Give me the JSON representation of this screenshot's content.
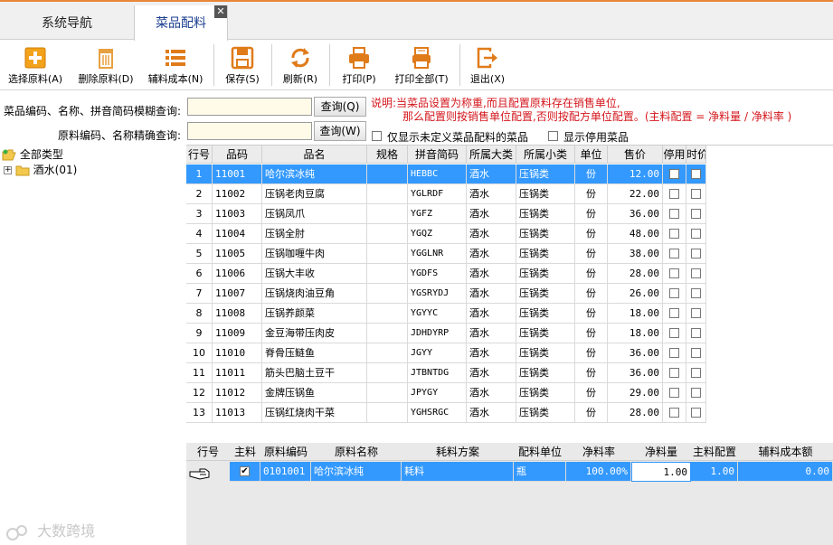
{
  "tabs": [
    {
      "label": "系统导航"
    },
    {
      "label": "菜品配料"
    }
  ],
  "tab_close": "✕",
  "toolbar": [
    {
      "label": "选择原料(A)",
      "icon": "plus-icon"
    },
    {
      "label": "删除原料(D)",
      "icon": "trash-icon"
    },
    {
      "label": "辅料成本(N)",
      "icon": "list-icon"
    },
    {
      "label": "保存(S)",
      "icon": "save-icon"
    },
    {
      "label": "刷新(R)",
      "icon": "refresh-icon"
    },
    {
      "label": "打印(P)",
      "icon": "printer-icon"
    },
    {
      "label": "打印全部(T)",
      "icon": "print-all-icon"
    },
    {
      "label": "退出(X)",
      "icon": "exit-icon"
    }
  ],
  "search": {
    "fuzzy_label": "菜品编码、名称、拼音简码模糊查询:",
    "fuzzy_value": "",
    "query1_label": "查询(Q)",
    "exact_label": "原料编码、名称精确查询:",
    "exact_value": "",
    "query2_label": "查询(W)"
  },
  "note": {
    "line1": "说明:当菜品设置为称重,而且配置原料存在销售单位,",
    "line2": "那么配置则按销售单位配置,否则按配方单位配置。(主料配置 = 净料量 / 净料率 )"
  },
  "options": {
    "only_undefined": "仅显示未定义菜品配料的菜品",
    "show_disabled": "显示停用菜品"
  },
  "tree": {
    "root": "全部类型",
    "child": "酒水(01)"
  },
  "dish_table": {
    "headers": [
      "行号",
      "品码",
      "品名",
      "规格",
      "拼音简码",
      "所属大类",
      "所属小类",
      "单位",
      "售价",
      "停用",
      "时价"
    ],
    "rows": [
      [
        "1",
        "11001",
        "哈尔滨冰纯",
        "",
        "HEBBC",
        "酒水",
        "压锅类",
        "份",
        "12.00"
      ],
      [
        "2",
        "11002",
        "压锅老肉豆腐",
        "",
        "YGLRDF",
        "酒水",
        "压锅类",
        "份",
        "22.00"
      ],
      [
        "3",
        "11003",
        "压锅凤爪",
        "",
        "YGFZ",
        "酒水",
        "压锅类",
        "份",
        "36.00"
      ],
      [
        "4",
        "11004",
        "压锅全肘",
        "",
        "YGQZ",
        "酒水",
        "压锅类",
        "份",
        "48.00"
      ],
      [
        "5",
        "11005",
        "压锅咖喱牛肉",
        "",
        "YGGLNR",
        "酒水",
        "压锅类",
        "份",
        "38.00"
      ],
      [
        "6",
        "11006",
        "压锅大丰收",
        "",
        "YGDFS",
        "酒水",
        "压锅类",
        "份",
        "28.00"
      ],
      [
        "7",
        "11007",
        "压锅烧肉油豆角",
        "",
        "YGSRYDJ",
        "酒水",
        "压锅类",
        "份",
        "26.00"
      ],
      [
        "8",
        "11008",
        "压锅养颜菜",
        "",
        "YGYYC",
        "酒水",
        "压锅类",
        "份",
        "18.00"
      ],
      [
        "9",
        "11009",
        "金豆海带压肉皮",
        "",
        "JDHDYRP",
        "酒水",
        "压锅类",
        "份",
        "18.00"
      ],
      [
        "10",
        "11010",
        "脊骨压鲢鱼",
        "",
        "JGYY",
        "酒水",
        "压锅类",
        "份",
        "36.00"
      ],
      [
        "11",
        "11011",
        "筋头巴脑土豆干",
        "",
        "JTBNTDG",
        "酒水",
        "压锅类",
        "份",
        "36.00"
      ],
      [
        "12",
        "11012",
        "金牌压锅鱼",
        "",
        "JPYGY",
        "酒水",
        "压锅类",
        "份",
        "29.00"
      ],
      [
        "13",
        "11013",
        "压锅红烧肉干菜",
        "",
        "YGHSRGC",
        "酒水",
        "压锅类",
        "份",
        "28.00"
      ]
    ]
  },
  "ingredient_table": {
    "headers": [
      "行号",
      "主料",
      "原料编码",
      "原料名称",
      "耗料方案",
      "配料单位",
      "净料率",
      "净料量",
      "主料配置",
      "辅料成本额"
    ],
    "rows": [
      [
        "",
        "",
        "0101001",
        "哈尔滨冰纯",
        "耗料",
        "瓶",
        "100.00%",
        "1.00",
        "1.00",
        "0.00"
      ]
    ]
  },
  "watermark": "大数跨境"
}
